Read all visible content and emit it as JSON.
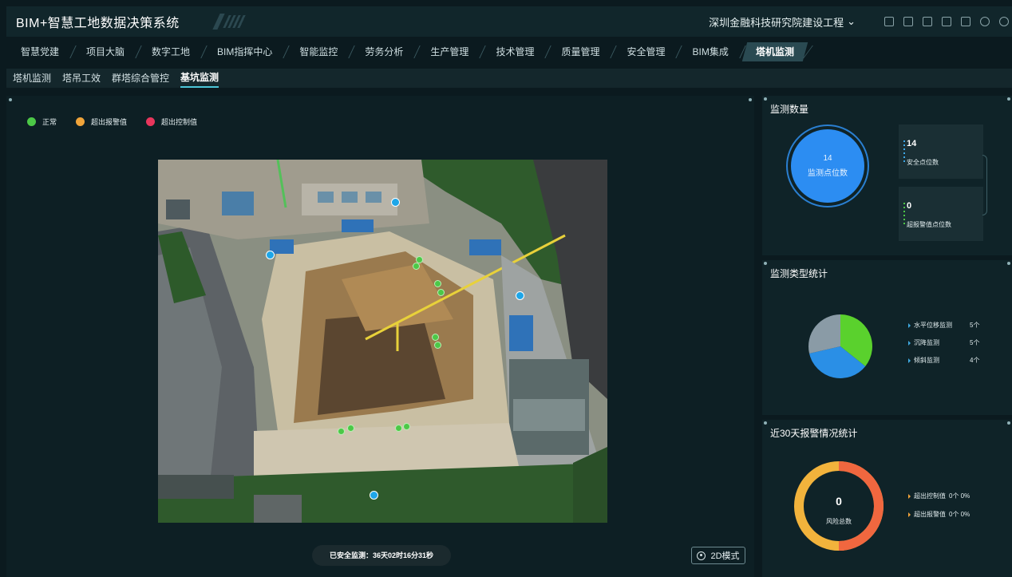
{
  "header": {
    "app_title": "BIM+智慧工地数据决策系统",
    "project": "深圳金融科技研究院建设工程",
    "icons": [
      "grid-icon",
      "monitor-icon",
      "document-icon",
      "screen-icon",
      "shirt-icon",
      "refresh-icon",
      "user-icon"
    ]
  },
  "module_tabs": [
    {
      "label": "智慧党建"
    },
    {
      "label": "项目大脑"
    },
    {
      "label": "数字工地"
    },
    {
      "label": "BIM指挥中心"
    },
    {
      "label": "智能监控"
    },
    {
      "label": "劳务分析"
    },
    {
      "label": "生产管理"
    },
    {
      "label": "技术管理"
    },
    {
      "label": "质量管理"
    },
    {
      "label": "安全管理"
    },
    {
      "label": "BIM集成"
    },
    {
      "label": "塔机监测"
    }
  ],
  "active_module": "塔机监测",
  "sub_tabs": [
    {
      "label": "塔机监测"
    },
    {
      "label": "塔吊工效"
    },
    {
      "label": "群塔综合管控"
    },
    {
      "label": "基坑监测"
    }
  ],
  "active_sub_tab": "基坑监测",
  "legend": [
    {
      "label": "正常",
      "color": "#4cc847"
    },
    {
      "label": "超出报警值",
      "color": "#f0a43a"
    },
    {
      "label": "超出控制值",
      "color": "#e8365c"
    }
  ],
  "map": {
    "safe_monitor_text": "已安全监测：36天02时16分31秒",
    "mode_button": "2D模式"
  },
  "monitor_count": {
    "title": "监测数量",
    "total_value": "14",
    "total_label": "监测点位数",
    "safe_value": "14",
    "safe_label": "安全点位数",
    "alarm_value": "0",
    "alarm_label": "超报警值点位数"
  },
  "type_stats": {
    "title": "监测类型统计",
    "items": [
      {
        "label": "水平位移监测",
        "value": "5个",
        "count": 5,
        "color": "#5ad12d"
      },
      {
        "label": "沉降监测",
        "value": "5个",
        "count": 5,
        "color": "#2a8fe6"
      },
      {
        "label": "倾斜监测",
        "value": "4个",
        "count": 4,
        "color": "#8a9ba6"
      }
    ]
  },
  "alarm_stats": {
    "title": "近30天报警情况统计",
    "total_value": "0",
    "total_label": "风险总数",
    "items": [
      {
        "label": "超出控制值",
        "value": "0个 0%"
      },
      {
        "label": "超出报警值",
        "value": "0个 0%"
      }
    ],
    "ring_colors": [
      "#f0673f",
      "#f2b33c"
    ]
  }
}
